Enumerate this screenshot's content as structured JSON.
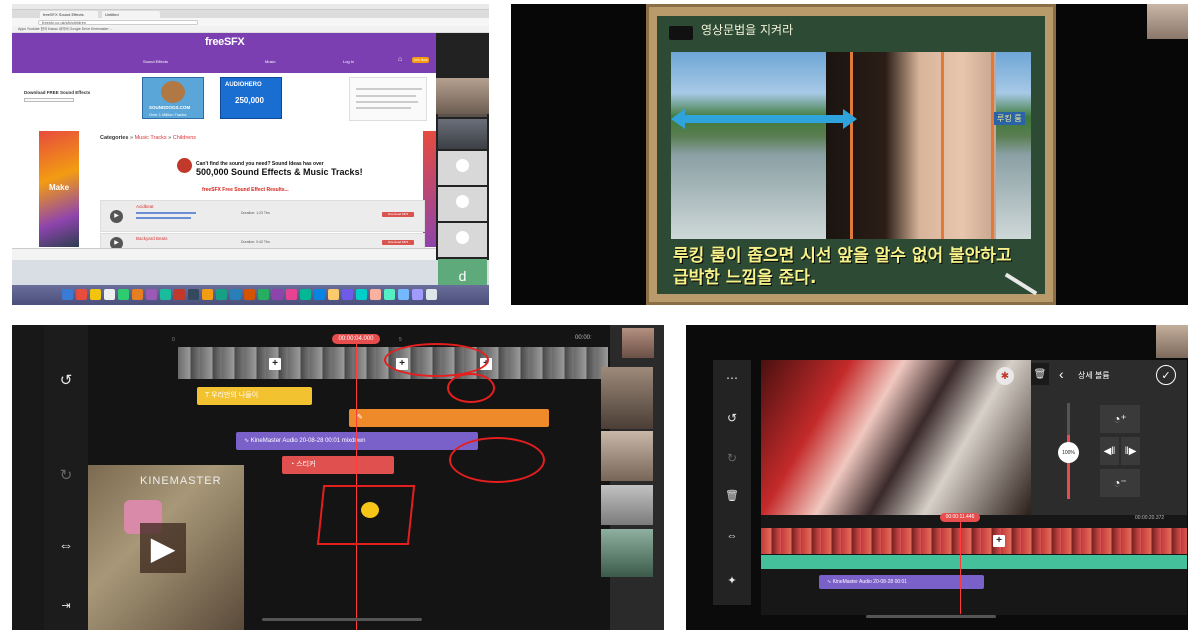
{
  "browser": {
    "tabs": [
      "freeSFX Sound Effects",
      "Untitled"
    ],
    "url": "freesfx.co.uk/sfx/children",
    "bookmarks": "Apps  Youtube  한국  Kakao  네이버  Google  Drive  Kinemaster  ...",
    "site": {
      "logo": "freeSFX",
      "nav": [
        "Sound Effects",
        "Music",
        "Log in"
      ],
      "join_label": "Join Now",
      "download_title": "Download FREE Sound Effects",
      "banner1_title": "SOUNDDOGS.COM",
      "banner1_sub": "Over 1 Million Tracks",
      "banner2_title": "AUDIOHERO",
      "banner2_sub": "250,000",
      "breadcrumb_prefix": "Categories",
      "breadcrumb_mid": "Music Tracks",
      "breadcrumb_current": "Childrens",
      "promo_small": "Can't find the sound you need? Sound Ideas has over",
      "promo_big": "500,000 Sound Effects & Music Tracks!",
      "results_title": "freeSFX Free Sound Effect Results...",
      "rows": [
        {
          "name": "Acidbeat",
          "duration": "Duration: 1:23 Tbs",
          "button": "Download MP3"
        },
        {
          "name": "Backyard Beats",
          "duration": "Duration: 0:42 Tbs",
          "button": "Download MP3"
        }
      ],
      "participant_initial": "d"
    }
  },
  "classroom": {
    "board_title": "영상문법을 지켜라",
    "tag": "루킹 룸",
    "subtitle_line1": "루킹 룸이 좁으면 시선 앞을 알수 없어 불안하고",
    "subtitle_line2": "급박한 느낌을 준다."
  },
  "editor_left": {
    "timecode": "00:00:04.000",
    "end_time": "00:00:",
    "layers": {
      "text_label": "우리만의 나들이",
      "audio_label": "KineMaster Audio 20-08-28 00:01 mixdown",
      "sticker_label": "스티커"
    },
    "preview_watermark": "KINEMASTER",
    "icons": [
      "undo-icon",
      "redo-icon",
      "split-icon",
      "export-icon"
    ]
  },
  "editor_right": {
    "header_title": "상세 볼륨",
    "volume_value": "100%",
    "timecode": "00:00:11.446",
    "end_time": "00:00:20.372",
    "audio_label": "KineMaster Audio 20-08-28 00:01"
  },
  "colors": {
    "freesfx_purple": "#7b3fb1",
    "kinemaster_red": "#e84d4d",
    "annotation_red": "#e51e1e",
    "subtitle_yellow": "#f7f28a"
  }
}
